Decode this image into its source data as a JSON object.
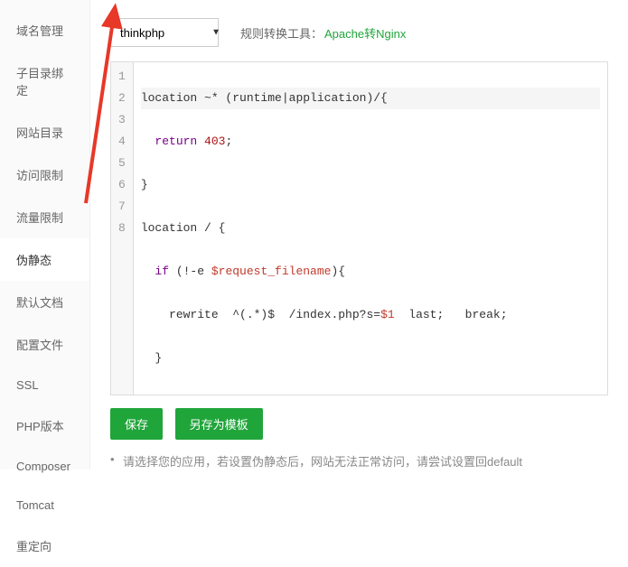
{
  "sidebar": {
    "items": [
      {
        "label": "域名管理"
      },
      {
        "label": "子目录绑定"
      },
      {
        "label": "网站目录"
      },
      {
        "label": "访问限制"
      },
      {
        "label": "流量限制"
      },
      {
        "label": "伪静态"
      },
      {
        "label": "默认文档"
      },
      {
        "label": "配置文件"
      },
      {
        "label": "SSL"
      },
      {
        "label": "PHP版本"
      },
      {
        "label": "Composer"
      },
      {
        "label": "Tomcat"
      },
      {
        "label": "重定向"
      }
    ]
  },
  "toolbar": {
    "template_selected": "thinkphp",
    "tool_label": "规则转换工具：",
    "tool_link": "Apache转Nginx"
  },
  "code": {
    "lines": [
      "1",
      "2",
      "3",
      "4",
      "5",
      "6",
      "7",
      "8"
    ],
    "l1a": "location ~* (runtime|application)/{",
    "l2a": "  ",
    "l2b": "return",
    "l2c": " ",
    "l2d": "403",
    "l2e": ";",
    "l3a": "}",
    "l4a": "location / {",
    "l5a": "  ",
    "l5b": "if",
    "l5c": " (!-e ",
    "l5d": "$request_filename",
    "l5e": "){",
    "l6a": "    rewrite  ^(.*)$  /index.php?s=",
    "l6b": "$1",
    "l6c": "  last;   break;",
    "l7a": "  }",
    "l8a": "}"
  },
  "buttons": {
    "save": "保存",
    "save_as": "另存为模板"
  },
  "hint": {
    "text": "请选择您的应用，若设置伪静态后，网站无法正常访问，请尝试设置回default"
  }
}
